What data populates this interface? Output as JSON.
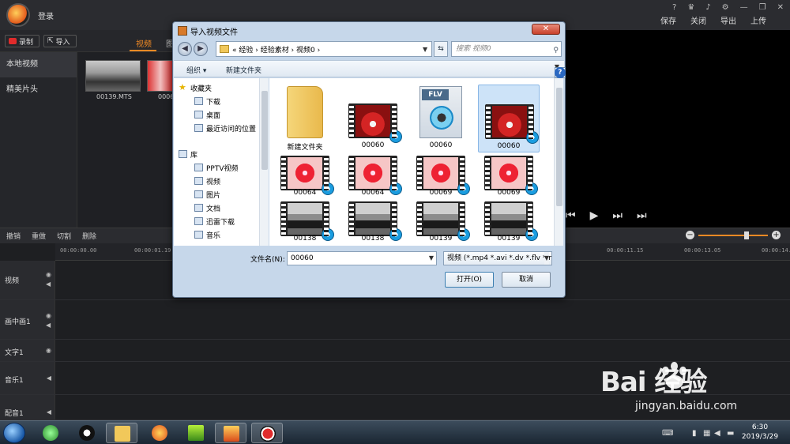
{
  "app": {
    "login": "登录",
    "top_actions": [
      "保存",
      "关闭",
      "导出",
      "上传"
    ],
    "record_label": "录制",
    "import_label": "导入",
    "tabs": [
      "视频",
      "图"
    ],
    "nav": [
      "本地视频",
      "精美片头"
    ],
    "media": [
      {
        "name": "00139.MTS"
      },
      {
        "name": "0006"
      }
    ],
    "edit_tools": [
      "撤销",
      "重做",
      "切割",
      "删除"
    ],
    "ruler": [
      "00:00:00.00",
      "00:00:01.19",
      "00:00:11.15",
      "00:00:13.05",
      "00:00:14.2"
    ],
    "tracks": [
      "视频",
      "画中画1",
      "文字1",
      "音乐1",
      "配音1"
    ]
  },
  "dialog": {
    "title": "导入视频文件",
    "breadcrumb": "« 经验 › 经验素材 › 视频0 ›",
    "search_placeholder": "搜索 视频0",
    "organize": "组织 ▾",
    "new_folder": "新建文件夹",
    "nav_favorites": "收藏夹",
    "nav_items": [
      "下载",
      "桌面",
      "最近访问的位置"
    ],
    "nav_library": "库",
    "nav_library_items": [
      "PPTV视频",
      "视频",
      "图片",
      "文档",
      "迅雷下载",
      "音乐"
    ],
    "files": [
      {
        "name": "新建文件夹",
        "kind": "folder"
      },
      {
        "name": "00060",
        "kind": "red"
      },
      {
        "name": "00060",
        "kind": "flv"
      },
      {
        "name": "00060",
        "kind": "red"
      },
      {
        "name": "00064",
        "kind": "red2"
      },
      {
        "name": "00064",
        "kind": "red2"
      },
      {
        "name": "00069",
        "kind": "red2"
      },
      {
        "name": "00069",
        "kind": "red2"
      },
      {
        "name": "00138",
        "kind": "car"
      },
      {
        "name": "00138",
        "kind": "car"
      },
      {
        "name": "00139",
        "kind": "car"
      },
      {
        "name": "00139",
        "kind": "car"
      }
    ],
    "selected_index": 3,
    "flv_label": "FLV",
    "filename_label": "文件名(N):",
    "filename_value": "00060",
    "filetype_value": "视频 (*.mp4 *.avi *.dv *.flv *.m",
    "open_label": "打开(O)",
    "cancel_label": "取消"
  },
  "taskbar": {
    "time": "6:30",
    "date": "2019/3/29"
  },
  "watermark": {
    "logo": "Bai  经验",
    "url": "jingyan.baidu.com"
  }
}
